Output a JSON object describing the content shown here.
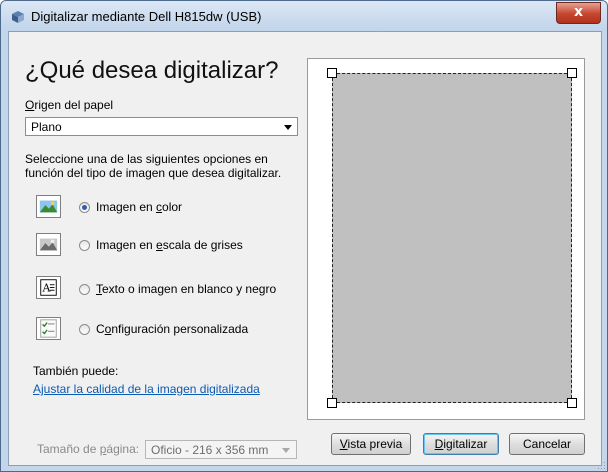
{
  "window": {
    "title": "Digitalizar mediante Dell H815dw (USB)",
    "close_glyph": "x"
  },
  "heading": "¿Qué desea digitalizar?",
  "paper_source": {
    "label": "Origen del papel",
    "label_accel": "O",
    "label_rest": "rigen del papel",
    "value": "Plano"
  },
  "instructions": "Seleccione una de las siguientes opciones en función del tipo de imagen que desea digitalizar.",
  "instructions_line1": "Seleccione una de las siguientes opciones en",
  "instructions_line2": "función del tipo de imagen que desea digitalizar.",
  "options": [
    {
      "label": "Imagen en color",
      "pre": "Imagen en ",
      "accel": "c",
      "post": "olor",
      "selected": true,
      "icon": "color-photo-icon"
    },
    {
      "label": "Imagen en escala de grises",
      "pre": "Imagen en ",
      "accel": "e",
      "post": "scala de grises",
      "selected": false,
      "icon": "grayscale-photo-icon"
    },
    {
      "label": "Texto o imagen en blanco y negro",
      "pre": "",
      "accel": "T",
      "post": "exto o imagen en blanco y negro",
      "selected": false,
      "icon": "bw-text-icon"
    },
    {
      "label": "Configuración personalizada",
      "pre": "C",
      "accel": "o",
      "post": "nfiguración personalizada",
      "selected": false,
      "icon": "custom-settings-icon"
    }
  ],
  "also_label": "También puede:",
  "quality_link": "Ajustar la calidad de la imagen digitalizada",
  "page_size": {
    "label": "Tamaño de página:",
    "label_pre": "Tamaño de ",
    "label_accel": "p",
    "label_post": "ágina:",
    "value": "Oficio - 216 x 356 mm"
  },
  "buttons": {
    "preview": {
      "label": "Vista previa",
      "accel": "V",
      "rest": "ista previa"
    },
    "scan": {
      "label": "Digitalizar",
      "accel": "D",
      "rest": "igitalizar"
    },
    "cancel": {
      "label": "Cancelar"
    }
  },
  "colors": {
    "link": "#0b5bb5",
    "radio_selected": "#2a5fb0",
    "scan_area": "#c0c0c0",
    "close_button": "#c5462f"
  }
}
